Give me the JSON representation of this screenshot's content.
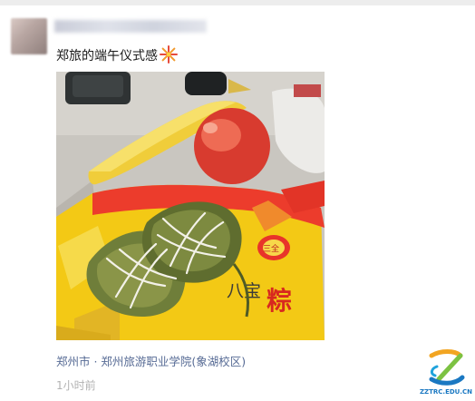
{
  "post": {
    "text": "郑旅的端午仪式感",
    "emoji": "firework-icon",
    "location": "郑州市 · 郑州旅游职业学院(象湖校区)",
    "time": "1小时前"
  },
  "photo": {
    "subject": "zongzi-photo",
    "package_lines": [
      "八宝",
      "粽"
    ]
  },
  "watermark": {
    "text": "ZZTRC.EDU.CN"
  },
  "colors": {
    "link": "#576b95",
    "time": "#b2b2b2",
    "text": "#1a1a1a"
  }
}
